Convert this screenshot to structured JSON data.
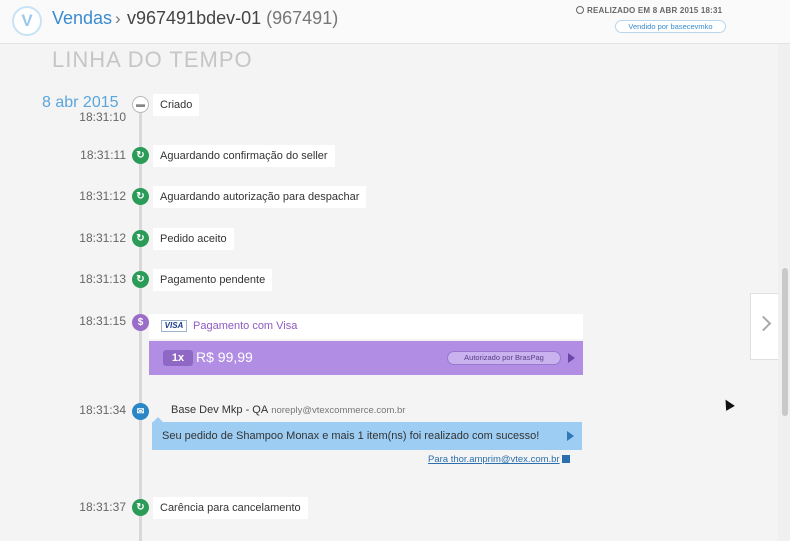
{
  "header": {
    "logo_letter": "V",
    "breadcrumb_link": "Vendas",
    "breadcrumb_separator": "›",
    "order_id": "v967491bdev-01",
    "order_number": "(967491)",
    "realized_text": "REALIZADO EM 8 ABR 2015 18:31",
    "seller_badge": "Vendido por basecevmko"
  },
  "section_title": "LINHA DO TEMPO",
  "date": "8 abr 2015",
  "events": [
    {
      "time": "18:31:10",
      "label": "Criado",
      "icon": "cart-icon"
    },
    {
      "time": "18:31:11",
      "label": "Aguardando confirmação do seller",
      "icon": "refresh-icon"
    },
    {
      "time": "18:31:12",
      "label": "Aguardando autorização para despachar",
      "icon": "refresh-icon"
    },
    {
      "time": "18:31:12",
      "label": "Pedido aceito",
      "icon": "refresh-icon"
    },
    {
      "time": "18:31:13",
      "label": "Pagamento pendente",
      "icon": "refresh-icon"
    },
    {
      "time": "18:31:37",
      "label": "Carência para cancelamento",
      "icon": "refresh-icon"
    }
  ],
  "payment": {
    "time": "18:31:15",
    "card_brand": "VISA",
    "title": "Pagamento com Visa",
    "quantity": "1x",
    "amount": "R$ 99,99",
    "authorization": "Autorizado por BrasPag",
    "icon": "dollar-icon",
    "accent_color": "#b18ee4"
  },
  "email": {
    "time": "18:31:34",
    "sender_name": "Base Dev Mkp - QA",
    "sender_address": "noreply@vtexcommerce.com.br",
    "message": "Seu pedido de Shampoo Monax e mais 1 item(ns) foi realizado com sucesso!",
    "recipient_link": "Para thor.amprim@vtex.com.br",
    "icon": "mail-icon",
    "accent_color": "#9dcdf2"
  },
  "colors": {
    "link_blue": "#3a8bd0",
    "status_green": "#2b9b58"
  }
}
